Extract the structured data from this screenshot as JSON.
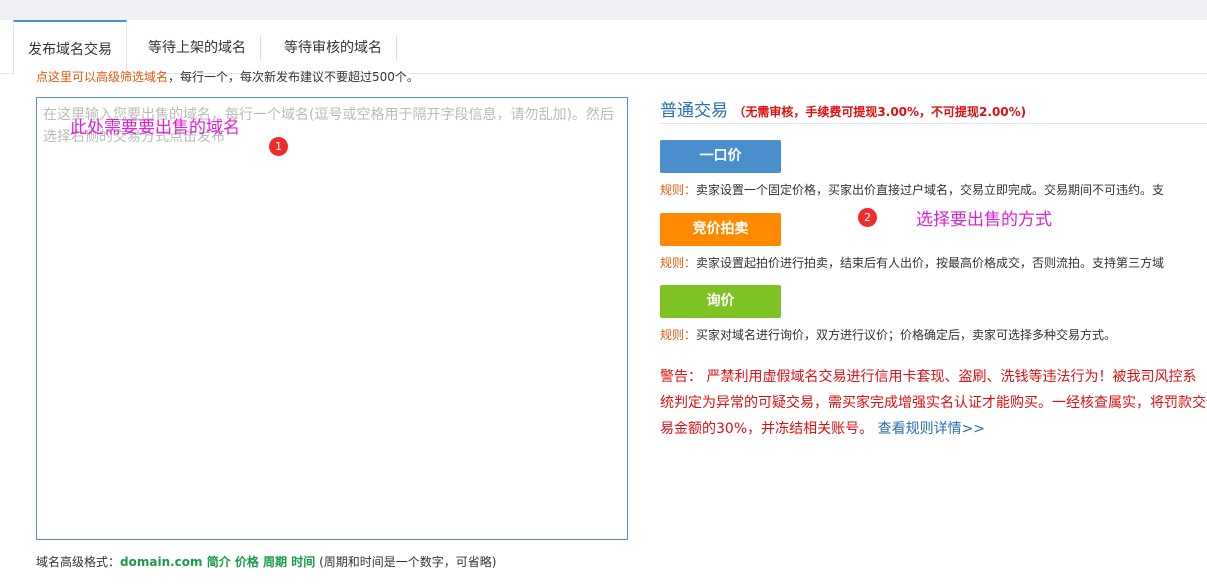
{
  "tabs": [
    {
      "label": "发布域名交易"
    },
    {
      "label": "等待上架的域名"
    },
    {
      "label": "等待审核的域名"
    }
  ],
  "hint": {
    "link": "点这里可以高级筛选域名",
    "text": "，每行一个，每次新发布建议不要超过500个。"
  },
  "domain_input": {
    "placeholder": "在这里输入您要出售的域名，每行一个域名(逗号或空格用于隔开字段信息，请勿乱加)。然后选择右侧的交易方式点击发布"
  },
  "annotations": {
    "a1_text": "此处需要要出售的域名",
    "a1_num": "1",
    "a2_text": "选择要出售的方式",
    "a2_num": "2"
  },
  "footer": {
    "label": "域名高级格式：",
    "format": "domain.com 简介 价格 周期 时间",
    "note": " (周期和时间是一个数字，可省略)"
  },
  "trade": {
    "title": "普通交易",
    "note": "（无需审核，手续费可提现3.00%，不可提现2.00%)"
  },
  "options": [
    {
      "label": "一口价",
      "rule_label": "规则：",
      "rule": "卖家设置一个固定价格，买家出价直接过户域名，交易立即完成。交易期间不可违约。支"
    },
    {
      "label": "竞价拍卖",
      "rule_label": "规则：",
      "rule": "卖家设置起拍价进行拍卖，结束后有人出价，按最高价格成交，否则流拍。支持第三方域"
    },
    {
      "label": "询价",
      "rule_label": "规则：",
      "rule": "买家对域名进行询价，双方进行议价；价格确定后，卖家可选择多种交易方式。"
    }
  ],
  "warning": {
    "label": "警告：",
    "text": " 严禁利用虚假域名交易进行信用卡套现、盗刷、洗钱等违法行为！被我司风控系统判定为异常的可疑交易，需买家完成增强实名认证才能购买。一经核查属实，将罚款交易金额的30%，并冻结相关账号。",
    "link": " 查看规则详情>>"
  },
  "colors": {
    "accent": "#2a6fb3",
    "blue_btn": "#4a8fcc",
    "orange_btn": "#ff8a00",
    "green_btn": "#7ec224",
    "warning": "#e01010",
    "annotation": "#e020d8"
  }
}
